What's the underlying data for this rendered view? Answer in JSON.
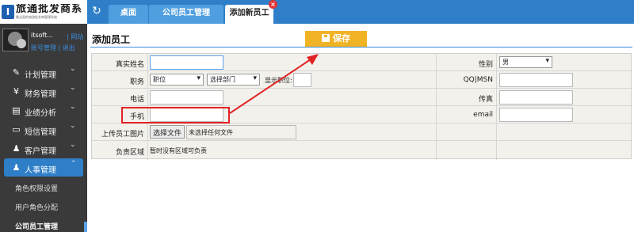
{
  "brand": {
    "logo_glyph": "I",
    "name": "旅通批发商系",
    "tagline": "最全面的旅游批发商管理系统"
  },
  "topbar": {
    "refresh_icon": "refresh-icon",
    "tabs": [
      {
        "label": "桌面"
      },
      {
        "label": "公司员工管理"
      },
      {
        "label": "添加新员工"
      }
    ],
    "close_glyph": "×"
  },
  "sidebar": {
    "user_name": "itsoft...",
    "site_link": "| 网站",
    "account_links": "账号管理 | 退出",
    "nav": [
      {
        "label": "计划管理",
        "icon": "edit-icon"
      },
      {
        "label": "财务管理",
        "icon": "money-icon"
      },
      {
        "label": "业绩分析",
        "icon": "bar-chart-icon"
      },
      {
        "label": "短信管理",
        "icon": "monitor-icon"
      },
      {
        "label": "客户管理",
        "icon": "user-plus-icon"
      },
      {
        "label": "人事管理",
        "icon": "user-icon"
      }
    ],
    "sub": [
      {
        "label": "角色权限设置"
      },
      {
        "label": "用户角色分配"
      },
      {
        "label": "公司员工管理"
      }
    ]
  },
  "main": {
    "title": "添加员工",
    "save_label": "保存",
    "form": {
      "real_name_label": "真实姓名",
      "real_name_value": "",
      "gender_label": "性别",
      "gender_value": "男",
      "position_label": "职务",
      "position_value": "职位",
      "dept_value": "选择部门",
      "display_position": "显示职位:",
      "qq_label": "QQ|MSN",
      "phone_label": "电话",
      "fax_label": "传真",
      "mobile_label": "手机",
      "email_label": "email",
      "photo_label": "上传员工图片",
      "file_button": "选择文件",
      "file_status": "未选择任何文件",
      "area_label": "负责区域",
      "area_value": "暂时没有区域可负责"
    }
  },
  "colors": {
    "topbar": "#2f7fc8",
    "sidebar": "#3a3a3a",
    "save": "#f0b325",
    "annotation": "#e02424"
  }
}
